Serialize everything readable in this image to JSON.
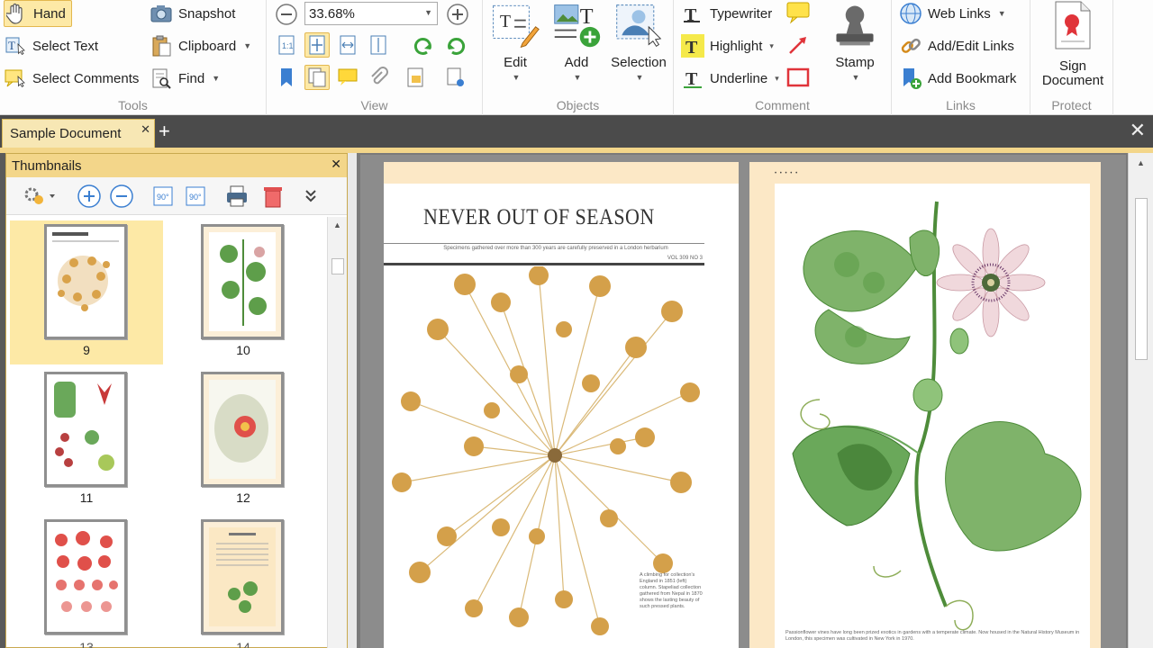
{
  "ribbon": {
    "tools": {
      "label": "Tools",
      "hand": "Hand",
      "select_text": "Select Text",
      "select_comments": "Select Comments",
      "snapshot": "Snapshot",
      "clipboard": "Clipboard",
      "find": "Find"
    },
    "view": {
      "label": "View",
      "zoom_value": "33.68%"
    },
    "objects": {
      "label": "Objects",
      "edit": "Edit",
      "add": "Add",
      "selection": "Selection"
    },
    "comment": {
      "label": "Comment",
      "typewriter": "Typewriter",
      "highlight": "Highlight",
      "underline": "Underline",
      "stamp": "Stamp"
    },
    "links": {
      "label": "Links",
      "web_links": "Web Links",
      "add_edit_links": "Add/Edit Links",
      "add_bookmark": "Add Bookmark"
    },
    "protect": {
      "label": "Protect",
      "sign_line1": "Sign",
      "sign_line2": "Document"
    }
  },
  "tabs": {
    "active": "Sample Document",
    "new_tab": "+",
    "close_all": "✕"
  },
  "thumbnails": {
    "title": "Thumbnails",
    "pages": [
      {
        "num": "9",
        "active": true
      },
      {
        "num": "10",
        "active": false
      },
      {
        "num": "11",
        "active": false
      },
      {
        "num": "12",
        "active": false
      },
      {
        "num": "13",
        "active": false
      },
      {
        "num": "14",
        "active": false
      }
    ]
  },
  "document": {
    "left_page": {
      "title": "NEVER OUT OF SEASON",
      "subtitle": "Specimens gathered over more than 300 years are carefully preserved in a London herbarium",
      "issue": "VOL 309 NO 3",
      "caption": "A climbing for collection's England in 1851 (left) column. Stapeliad collection gathered from Nepal in 1870 shows the lasting beauty of such pressed plants."
    },
    "right_page": {
      "header_mark": "• • • • •",
      "caption": "Passionflower vines have long been prized exotics in gardens with a temperate climate. Now housed in the Natural History Museum in London, this specimen was cultivated in New York in 1970."
    }
  },
  "colors": {
    "accent": "#f3d68a",
    "selected": "#fde9a6",
    "page_bg": "#fce8c6"
  }
}
